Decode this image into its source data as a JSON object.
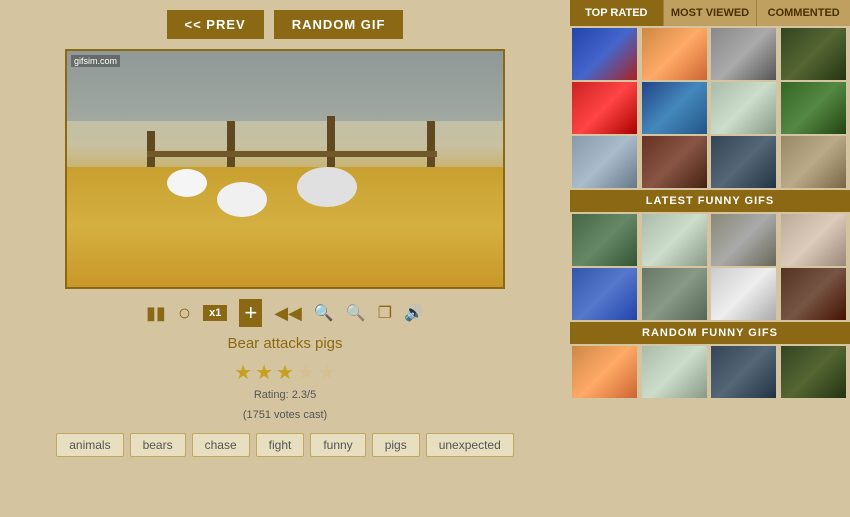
{
  "header": {
    "prev_label": "<< PREV",
    "random_label": "RANDOM GIF"
  },
  "gif": {
    "watermark": "gifsim.com",
    "title": "Bear attacks pigs",
    "rating_text": "Rating: 2.3/5",
    "votes_text": "(1751 votes cast)"
  },
  "controls": {
    "pause": "⏸",
    "minus": "−",
    "x1": "x1",
    "plus": "+",
    "rewind": "⏮",
    "zoom_out": "🔍",
    "zoom_in": "🔍",
    "expand": "⛶",
    "sound": "🔊"
  },
  "stars": [
    {
      "type": "filled"
    },
    {
      "type": "filled"
    },
    {
      "type": "half"
    },
    {
      "type": "empty"
    },
    {
      "type": "empty"
    }
  ],
  "tags": [
    "animals",
    "bears",
    "chase",
    "fight",
    "funny",
    "pigs",
    "unexpected"
  ],
  "tabs": [
    {
      "label": "TOP RATED",
      "active": true
    },
    {
      "label": "MOST VIEWED",
      "active": false
    },
    {
      "label": "COMMENTED",
      "active": false
    }
  ],
  "latest_section": {
    "label": "LATEST FUNNY GIFS"
  },
  "random_section": {
    "label": "RANDOM FUNNY GIFS"
  },
  "top_thumbs": [
    {
      "cls": "t1"
    },
    {
      "cls": "t2"
    },
    {
      "cls": "t3"
    },
    {
      "cls": "t4"
    },
    {
      "cls": "t5"
    },
    {
      "cls": "t6"
    },
    {
      "cls": "t7"
    },
    {
      "cls": "t8"
    },
    {
      "cls": "t9"
    },
    {
      "cls": "t10"
    },
    {
      "cls": "t11"
    },
    {
      "cls": "t12"
    }
  ],
  "latest_thumbs": [
    {
      "cls": "t13"
    },
    {
      "cls": "t14"
    },
    {
      "cls": "t15"
    },
    {
      "cls": "t16"
    },
    {
      "cls": "t17"
    },
    {
      "cls": "t18"
    },
    {
      "cls": "t19"
    },
    {
      "cls": "t20"
    }
  ],
  "random_thumbs": [
    {
      "cls": "t2"
    },
    {
      "cls": "t7"
    },
    {
      "cls": "t11"
    },
    {
      "cls": "t4"
    }
  ]
}
